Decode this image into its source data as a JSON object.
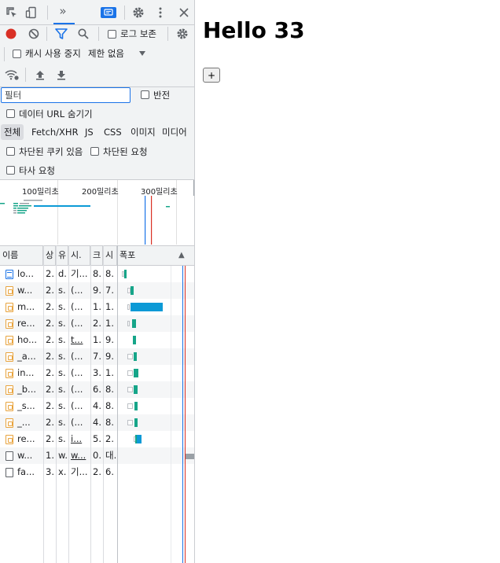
{
  "toolbar": {
    "more_tabs": "»",
    "icons": [
      "inspect-icon",
      "device-toggle-icon",
      "chevron-double-right-icon",
      "console-messages-icon",
      "settings-icon",
      "kebab-menu-icon",
      "close-icon"
    ]
  },
  "network_controls": {
    "preserve_log_label": "로그 보존",
    "disable_cache_label": "캐시 사용 중지",
    "throttling_label": "제한 없음"
  },
  "filter": {
    "placeholder": "필터",
    "invert_label": "반전",
    "hide_data_urls_label": "데이터 URL 숨기기",
    "types": [
      "전체",
      "Fetch/XHR",
      "JS",
      "CSS",
      "이미지",
      "미디어"
    ],
    "active_type": "전체",
    "blocked_cookies_label": "차단된 쿠키 있음",
    "blocked_requests_label": "차단된 요청",
    "third_party_label": "타사 요청"
  },
  "overview": {
    "ticks": [
      "100밀리초",
      "200밀리초",
      "300밀리초"
    ]
  },
  "table": {
    "headers": {
      "name": "이름",
      "status": "상",
      "type": "유",
      "initiator": "시.",
      "size": "크",
      "time": "시",
      "waterfall": "폭포",
      "sort_indicator": "▲"
    },
    "rows": [
      {
        "name": "lo...",
        "status": "2.",
        "type": "d.",
        "initiator": "기...",
        "size": "8.",
        "time": "8.",
        "icon": "doc"
      },
      {
        "name": "w...",
        "status": "2.",
        "type": "s.",
        "initiator": "(...",
        "size": "9.",
        "time": "7.",
        "icon": "js"
      },
      {
        "name": "m...",
        "status": "2.",
        "type": "s.",
        "initiator": "(...",
        "size": "1.",
        "time": "1.",
        "icon": "js"
      },
      {
        "name": "re...",
        "status": "2.",
        "type": "s.",
        "initiator": "(...",
        "size": "2.",
        "time": "1.",
        "icon": "js"
      },
      {
        "name": "ho...",
        "status": "2.",
        "type": "s.",
        "initiator": "t...",
        "size": "1.",
        "time": "9.",
        "icon": "js"
      },
      {
        "name": "_a...",
        "status": "2.",
        "type": "s.",
        "initiator": "(...",
        "size": "7.",
        "time": "9.",
        "icon": "js"
      },
      {
        "name": "in...",
        "status": "2.",
        "type": "s.",
        "initiator": "(...",
        "size": "3.",
        "time": "1.",
        "icon": "js"
      },
      {
        "name": "_b...",
        "status": "2.",
        "type": "s.",
        "initiator": "(...",
        "size": "6.",
        "time": "8.",
        "icon": "js"
      },
      {
        "name": "_s...",
        "status": "2.",
        "type": "s.",
        "initiator": "(...",
        "size": "4.",
        "time": "8.",
        "icon": "js"
      },
      {
        "name": "_...",
        "status": "2.",
        "type": "s.",
        "initiator": "(...",
        "size": "4.",
        "time": "8.",
        "icon": "js"
      },
      {
        "name": "re...",
        "status": "2.",
        "type": "s.",
        "initiator": "i...",
        "size": "5.",
        "time": "2.",
        "icon": "js"
      },
      {
        "name": "w...",
        "status": "1.",
        "type": "w.",
        "initiator": "w...",
        "size": "0.",
        "time": "대.",
        "icon": "blank"
      },
      {
        "name": "fa...",
        "status": "3.",
        "type": "x.",
        "initiator": "기...",
        "size": "2.",
        "time": "6.",
        "icon": "blank"
      }
    ]
  },
  "page": {
    "heading": "Hello 33",
    "button_label": "+"
  },
  "colors": {
    "record": "#d93025",
    "accent": "#1a73e8",
    "waterfall_queue": "#bdc1c6",
    "waterfall_wait": "#16a589",
    "waterfall_download": "#0c9ad6"
  }
}
